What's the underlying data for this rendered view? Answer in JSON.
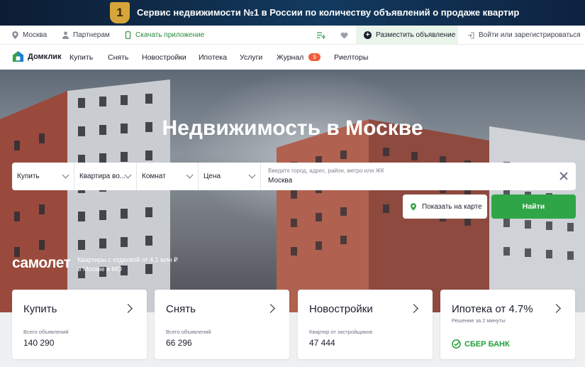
{
  "promo_banner": {
    "badge": "1",
    "text": "Сервис недвижимости №1 в России по количеству объявлений о продаже квартир"
  },
  "utility_bar": {
    "city": "Москва",
    "partners": "Партнерам",
    "download_app": "Скачать приложение",
    "post_ad": "Разместить объявление",
    "login": "Войти или зарегистрироваться"
  },
  "nav": {
    "logo": "Домклик",
    "items": [
      {
        "label": "Купить"
      },
      {
        "label": "Снять"
      },
      {
        "label": "Новостройки"
      },
      {
        "label": "Ипотека"
      },
      {
        "label": "Услуги"
      },
      {
        "label": "Журнал",
        "badge": "9"
      },
      {
        "label": "Риелторы"
      }
    ]
  },
  "hero": {
    "title": "Недвижимость в Москве"
  },
  "search": {
    "deal_type": "Купить",
    "property_type": "Квартира во...",
    "rooms": "Комнат",
    "price": "Цена",
    "address_placeholder": "Введите город, адрес, район, метро или ЖК",
    "address_value": "Москва",
    "map_button": "Показать на карте",
    "find_button": "Найти"
  },
  "ad": {
    "brand": "самолет",
    "line1": "Квартиры с отделкой  от 4,1 млн ₽",
    "line2": "в Москве и МО"
  },
  "cards": [
    {
      "title": "Купить",
      "subtitle": "Всего объявлений",
      "value": "140 290"
    },
    {
      "title": "Снять",
      "subtitle": "Всего объявлений",
      "value": "66 296"
    },
    {
      "title": "Новостройки",
      "subtitle": "Квартир от застройщиков",
      "value": "47 444"
    },
    {
      "title": "Ипотека от 4.7%",
      "subtitle": "Решение за 2 минуты",
      "brand": "СБЕР БАНК"
    }
  ],
  "colors": {
    "accent_green": "#2fa547",
    "badge_red": "#f25c3b",
    "sber_green": "#21a038"
  }
}
